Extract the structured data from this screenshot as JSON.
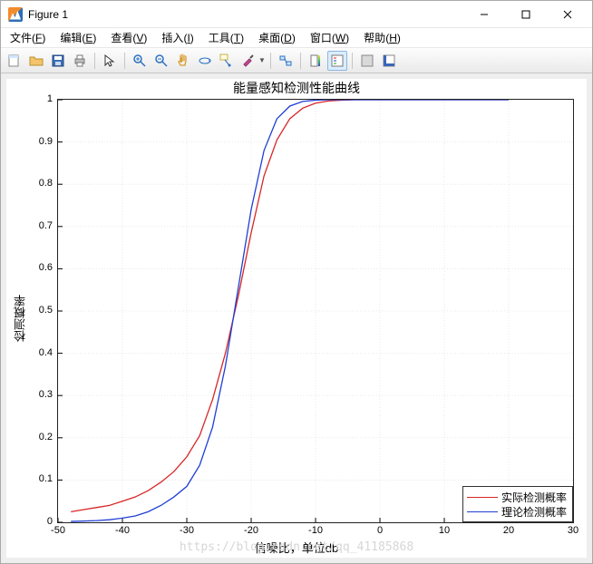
{
  "window": {
    "title": "Figure 1"
  },
  "menu": {
    "file": {
      "label": "文件",
      "accel": "F"
    },
    "edit": {
      "label": "编辑",
      "accel": "E"
    },
    "view": {
      "label": "查看",
      "accel": "V"
    },
    "insert": {
      "label": "插入",
      "accel": "I"
    },
    "tools": {
      "label": "工具",
      "accel": "T"
    },
    "desktop": {
      "label": "桌面",
      "accel": "D"
    },
    "window": {
      "label": "窗口",
      "accel": "W"
    },
    "help": {
      "label": "帮助",
      "accel": "H"
    }
  },
  "chart_data": {
    "type": "line",
    "title": "能量感知检测性能曲线",
    "xlabel": "信噪比，单位db",
    "ylabel": "检测概率",
    "xlim": [
      -50,
      30
    ],
    "ylim": [
      0,
      1
    ],
    "xticks": [
      -50,
      -40,
      -30,
      -20,
      -10,
      0,
      10,
      20,
      30
    ],
    "yticks": [
      0,
      0.1,
      0.2,
      0.3,
      0.4,
      0.5,
      0.6,
      0.7,
      0.8,
      0.9,
      1
    ],
    "series": [
      {
        "name": "实际检测概率",
        "color": "#d62728",
        "x": [
          -48,
          -46,
          -44,
          -42,
          -40,
          -38,
          -36,
          -34,
          -32,
          -30,
          -28,
          -26,
          -24,
          -22,
          -20,
          -18,
          -16,
          -14,
          -12,
          -10,
          -8,
          -6,
          -4,
          -2,
          0,
          5,
          10,
          15,
          20
        ],
        "y": [
          0.025,
          0.03,
          0.035,
          0.04,
          0.05,
          0.06,
          0.075,
          0.095,
          0.12,
          0.155,
          0.205,
          0.29,
          0.4,
          0.535,
          0.685,
          0.82,
          0.905,
          0.955,
          0.98,
          0.992,
          0.997,
          0.999,
          1.0,
          1.0,
          1.0,
          1.0,
          1.0,
          1.0,
          1.0
        ]
      },
      {
        "name": "理论检测概率",
        "color": "#1f3fd4",
        "x": [
          -48,
          -46,
          -44,
          -42,
          -40,
          -38,
          -36,
          -34,
          -32,
          -30,
          -28,
          -26,
          -24,
          -22,
          -20,
          -18,
          -16,
          -14,
          -12,
          -10,
          -8,
          -6,
          -4,
          -2,
          0,
          5,
          10,
          15,
          20
        ],
        "y": [
          0.002,
          0.003,
          0.004,
          0.006,
          0.01,
          0.015,
          0.025,
          0.04,
          0.06,
          0.085,
          0.135,
          0.225,
          0.37,
          0.555,
          0.74,
          0.88,
          0.955,
          0.985,
          0.996,
          0.999,
          1.0,
          1.0,
          1.0,
          1.0,
          1.0,
          1.0,
          1.0,
          1.0,
          1.0
        ]
      }
    ]
  },
  "legend": {
    "items": [
      {
        "label": "实际检测概率",
        "color": "#d62728"
      },
      {
        "label": "理论检测概率",
        "color": "#1f3fd4"
      }
    ]
  },
  "watermark": "https://blog.csdn.net/qq_41185868"
}
